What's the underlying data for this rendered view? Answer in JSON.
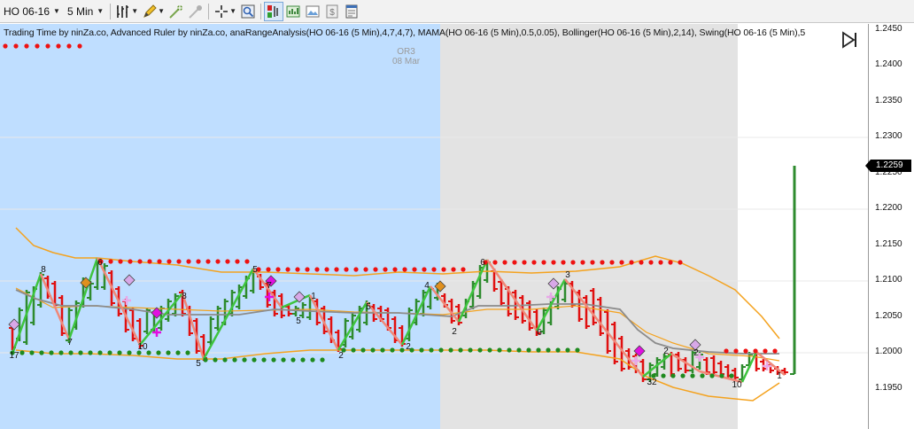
{
  "toolbar": {
    "instrument": "HO 06-16",
    "interval": "5 Min",
    "icons": [
      "bar-style-icon",
      "pencil-icon",
      "add-indicator-icon",
      "remove-indicator-icon",
      "crosshair-icon",
      "zoom-icon",
      "chart-trader-icon",
      "strategies-icon",
      "image-icon",
      "dollar-icon",
      "properties-icon"
    ]
  },
  "chart": {
    "indicator_label": "Trading Time by ninZa.co, Advanced Ruler by ninZa.co, anaRangeAnalysis(HO 06-16 (5 Min),4,7,4,7), MAMA(HO 06-16 (5 Min),0.5,0.05), Bollinger(HO 06-16 (5 Min),2,14), Swing(HO 06-16 (5 Min),5",
    "session_name": "OR3",
    "session_date": "08 Mar",
    "colors": {
      "session_blue": "#bfdeff",
      "session_gray": "#e3e3e3",
      "bull": "#2e8b2e",
      "bear": "#e01010",
      "zigzag_up": "#3ec43e",
      "zigzag_down": "#f08878",
      "bollinger": "#f4a21e",
      "mama": "#8c8c8c",
      "resistance_dots": "#ee1111",
      "support_dots": "#1e8a1e"
    },
    "swing_labels": [
      "17",
      "8",
      "7",
      "6",
      "10",
      "8",
      "5",
      "5",
      "7",
      "5",
      "1",
      "2",
      "5",
      "2",
      "4",
      "2",
      "6",
      "6",
      "3",
      "2",
      "32",
      "2",
      "10",
      "1"
    ]
  },
  "axis": {
    "ticks": [
      "1.2450",
      "1.2400",
      "1.2350",
      "1.2300",
      "1.2250",
      "1.2200",
      "1.2150",
      "1.2100",
      "1.2050",
      "1.2000",
      "1.1950"
    ],
    "current_price": "1.2259"
  }
}
